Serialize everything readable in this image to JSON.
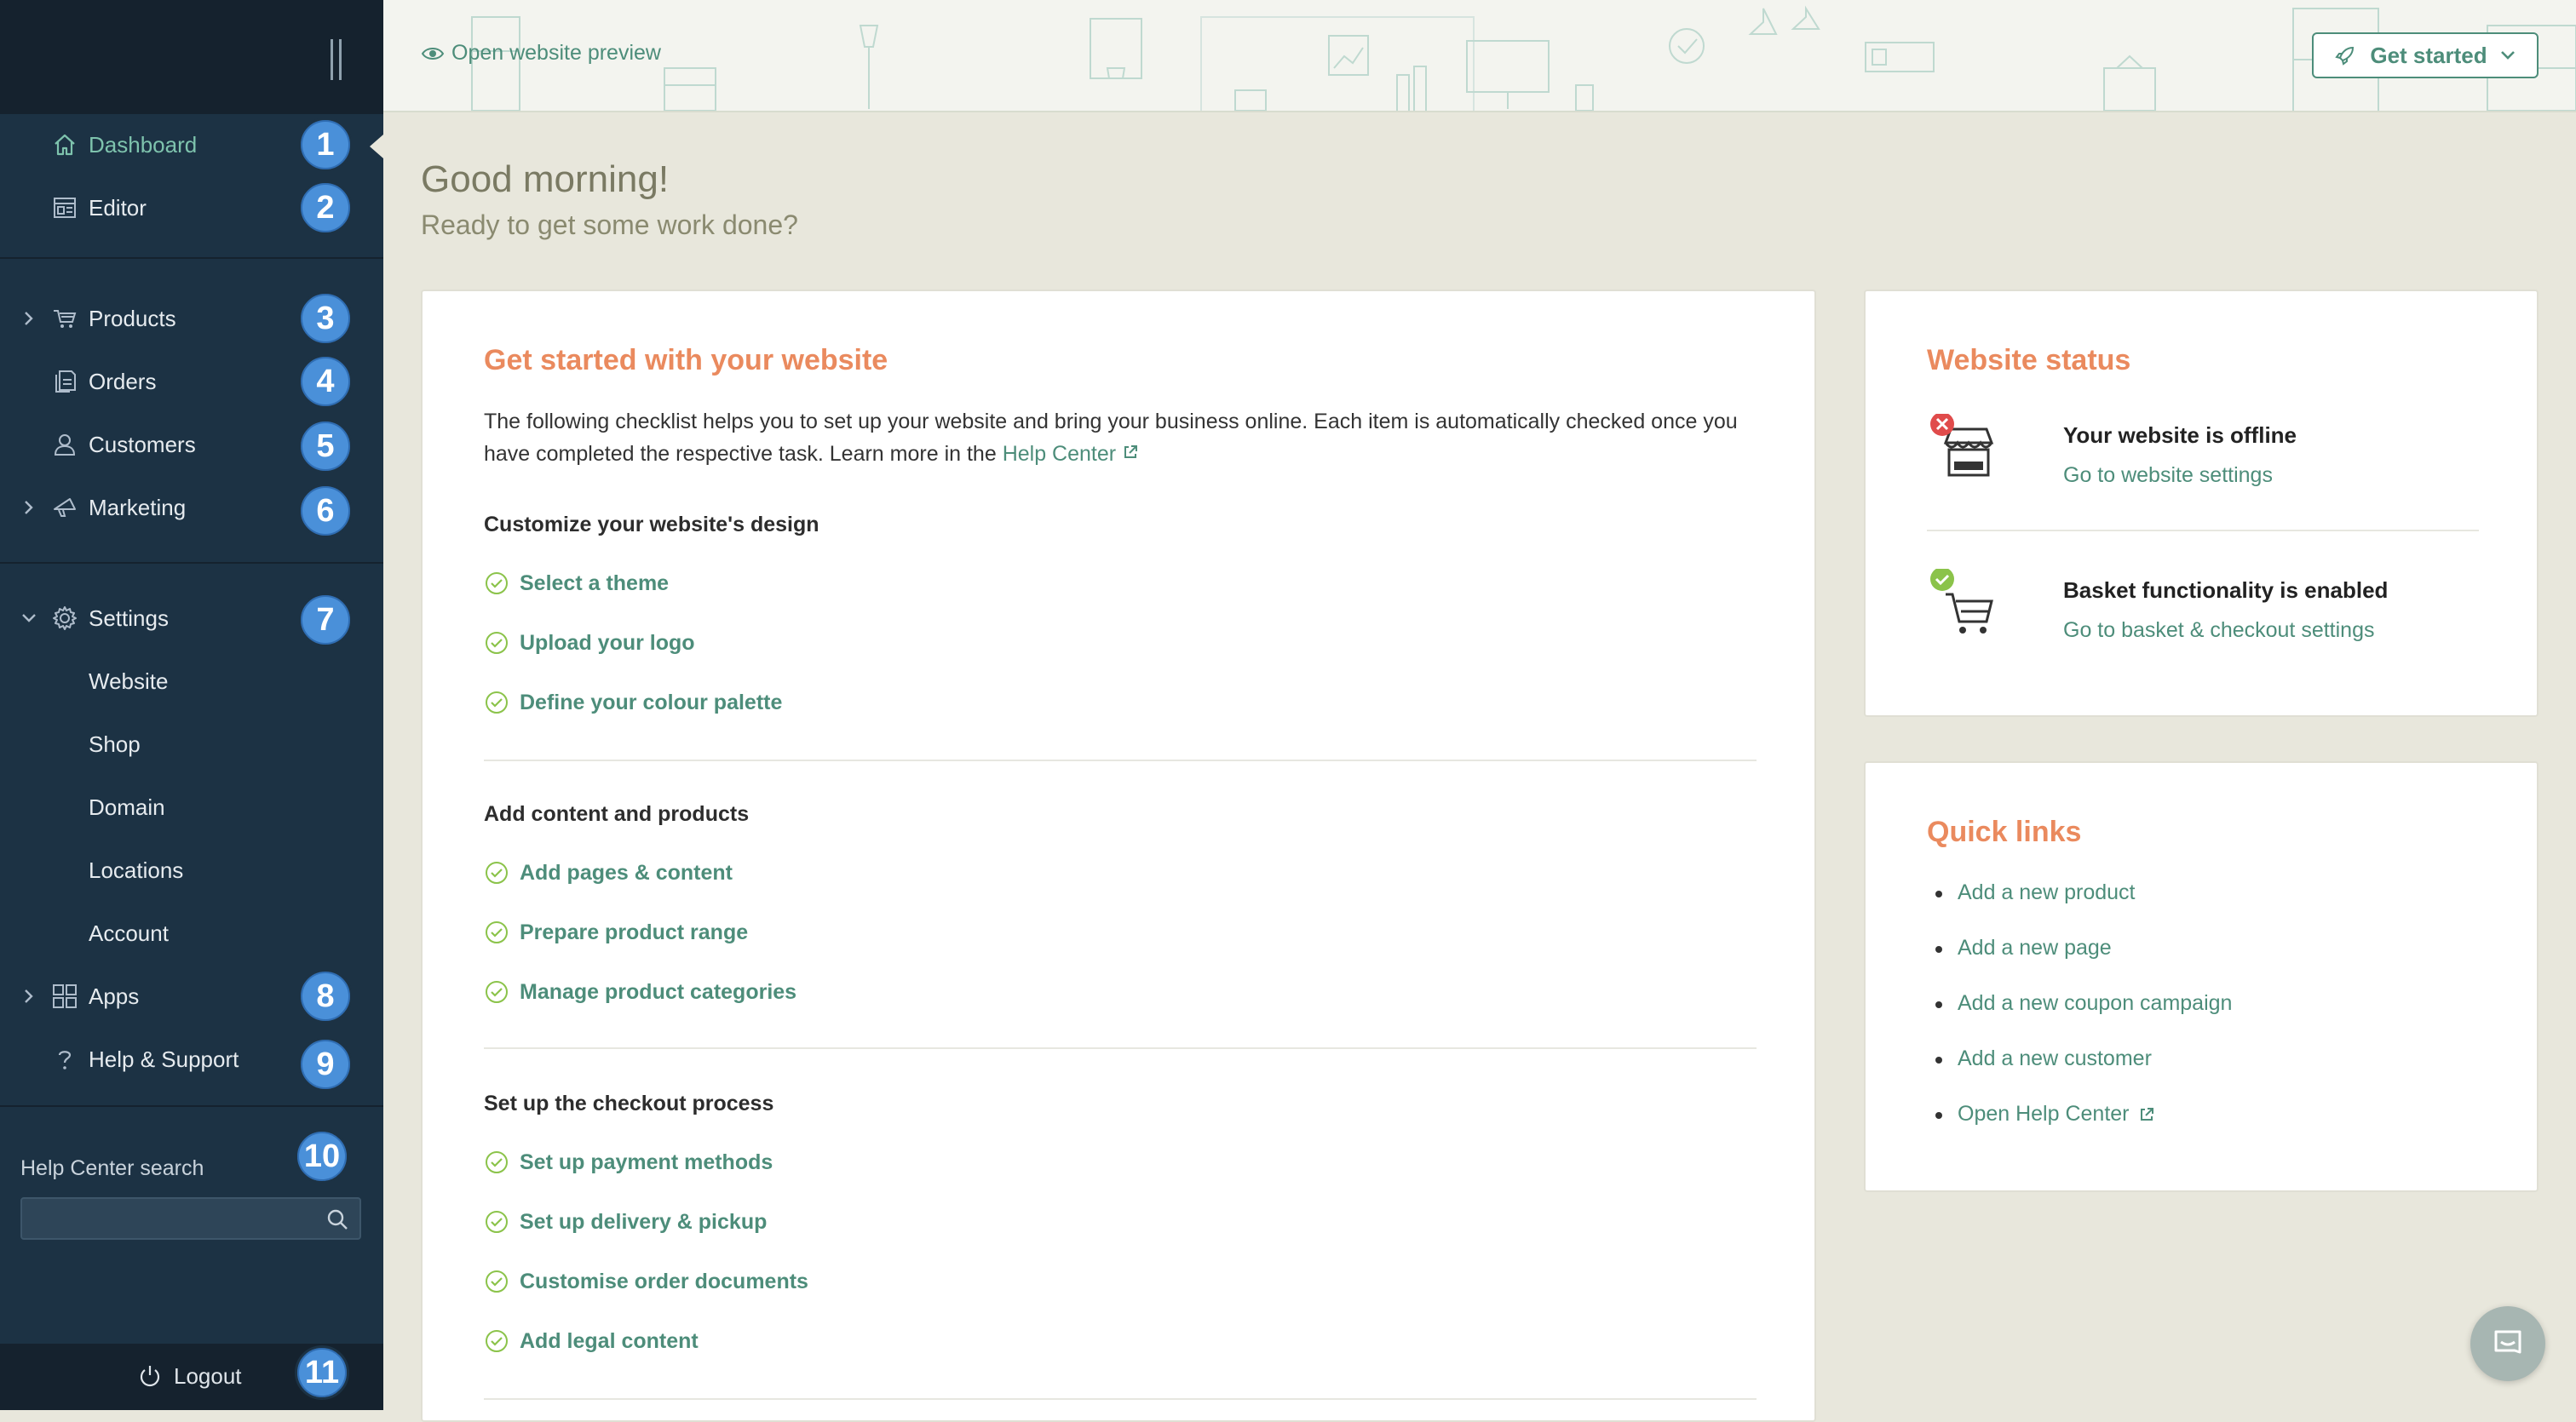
{
  "sidebar": {
    "items": [
      {
        "label": "Dashboard",
        "badge": "1",
        "icon": "home-icon"
      },
      {
        "label": "Editor",
        "badge": "2",
        "icon": "editor-icon"
      },
      {
        "label": "Products",
        "badge": "3",
        "icon": "cart-icon"
      },
      {
        "label": "Orders",
        "badge": "4",
        "icon": "orders-icon"
      },
      {
        "label": "Customers",
        "badge": "5",
        "icon": "user-icon"
      },
      {
        "label": "Marketing",
        "badge": "6",
        "icon": "megaphone-icon"
      },
      {
        "label": "Settings",
        "badge": "7",
        "icon": "gear-icon"
      },
      {
        "label": "Website"
      },
      {
        "label": "Shop"
      },
      {
        "label": "Domain"
      },
      {
        "label": "Locations"
      },
      {
        "label": "Account"
      },
      {
        "label": "Apps",
        "badge": "8",
        "icon": "apps-icon"
      },
      {
        "label": "Help & Support",
        "badge": "9",
        "icon": "help-icon"
      }
    ],
    "help_search": {
      "label": "Help Center search",
      "badge": "10",
      "placeholder": ""
    },
    "logout": {
      "label": "Logout",
      "badge": "11"
    }
  },
  "header": {
    "preview_link": "Open website preview",
    "get_started": "Get started"
  },
  "main": {
    "greeting": "Good morning!",
    "subgreeting": "Ready to get some work done?",
    "checklist": {
      "title": "Get started with your website",
      "intro": "The following checklist helps you to set up your website and bring your business online. Each item is automatically checked once you have completed the respective task. Learn more in the",
      "intro_link": "Help Center",
      "sections": [
        {
          "title": "Customize your website's design",
          "items": [
            "Select a theme",
            "Upload your logo",
            "Define your colour palette"
          ]
        },
        {
          "title": "Add content and products",
          "items": [
            "Add pages & content",
            "Prepare product range",
            "Manage product categories"
          ]
        },
        {
          "title": "Set up the checkout process",
          "items": [
            "Set up payment methods",
            "Set up delivery & pickup",
            "Customise order documents",
            "Add legal content"
          ]
        }
      ]
    },
    "status": {
      "title": "Website status",
      "rows": [
        {
          "title": "Your website is offline",
          "link": "Go to website settings",
          "state": "error"
        },
        {
          "title": "Basket functionality is enabled",
          "link": "Go to basket & checkout settings",
          "state": "ok"
        }
      ]
    },
    "quick_links": {
      "title": "Quick links",
      "items": [
        "Add a new product",
        "Add a new page",
        "Add a new coupon campaign",
        "Add a new customer",
        "Open Help Center"
      ]
    }
  },
  "colors": {
    "sidebar_bg": "#1c3244",
    "accent": "#4d8d7a",
    "title_orange": "#ea8a5e",
    "badge_blue": "#4a90d9",
    "page_bg": "#e8e7dc"
  }
}
